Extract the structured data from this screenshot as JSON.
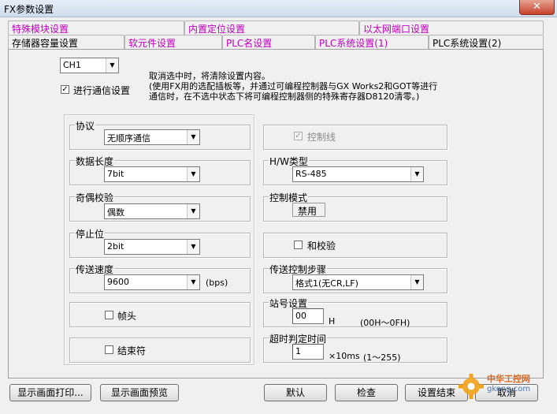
{
  "window": {
    "title": "FX参数设置",
    "close": "✕"
  },
  "tabs_row1": [
    {
      "label": "特殊模块设置",
      "color": "#c000c0"
    },
    {
      "label": "内置定位设置",
      "color": "#c000c0"
    },
    {
      "label": "以太网端口设置",
      "color": "#c000c0"
    }
  ],
  "tabs_row2": [
    {
      "label": "存储器容量设置"
    },
    {
      "label": "软元件设置",
      "color": "#c000c0"
    },
    {
      "label": "PLC名设置",
      "color": "#c000c0"
    },
    {
      "label": "PLC系统设置(1)",
      "color": "#c000c0"
    },
    {
      "label": "PLC系统设置(2)",
      "active": true
    }
  ],
  "channel": {
    "value": "CH1"
  },
  "comm_setting": {
    "label": "进行通信设置",
    "checked": true
  },
  "note": {
    "line1": "取消选中时，将清除设置内容。",
    "line2": "(使用FX用的选配插板等，并通过可编程控制器与GX Works2和GOT等进行",
    "line3": "通信时，在不选中状态下将可编程控制器侧的特殊寄存器D8120清零。)"
  },
  "protocol": {
    "title": "协议",
    "value": "无顺序通信"
  },
  "data_length": {
    "title": "数据长度",
    "value": "7bit"
  },
  "parity": {
    "title": "奇偶校验",
    "value": "偶数"
  },
  "stop_bit": {
    "title": "停止位",
    "value": "2bit"
  },
  "baud_rate": {
    "title": "传送速度",
    "value": "9600",
    "unit": "(bps)"
  },
  "header": {
    "label": "帧头"
  },
  "terminator": {
    "label": "结束符"
  },
  "control_line": {
    "label": "控制线",
    "checked": true,
    "disabled": true
  },
  "hw_type": {
    "title": "H/W类型",
    "value": "RS-485"
  },
  "control_mode": {
    "title": "控制模式",
    "value": "禁用"
  },
  "sum_check": {
    "label": "和校验"
  },
  "transfer_control": {
    "title": "传送控制步骤",
    "value": "格式1(无CR,LF)"
  },
  "station_no": {
    "title": "站号设置",
    "value": "00",
    "unit": "H",
    "range": "(00H～0FH)"
  },
  "timeout": {
    "title": "超时判定时间",
    "value": "1",
    "unit": "×10ms",
    "range": "(1～255)"
  },
  "buttons": {
    "print": "显示画面打印...",
    "preview": "显示画面预览",
    "default": "默认",
    "check": "检查",
    "finish": "设置结束",
    "cancel": "取消"
  },
  "watermark": {
    "line1": "中华工控网",
    "line2": "gkong.com"
  }
}
